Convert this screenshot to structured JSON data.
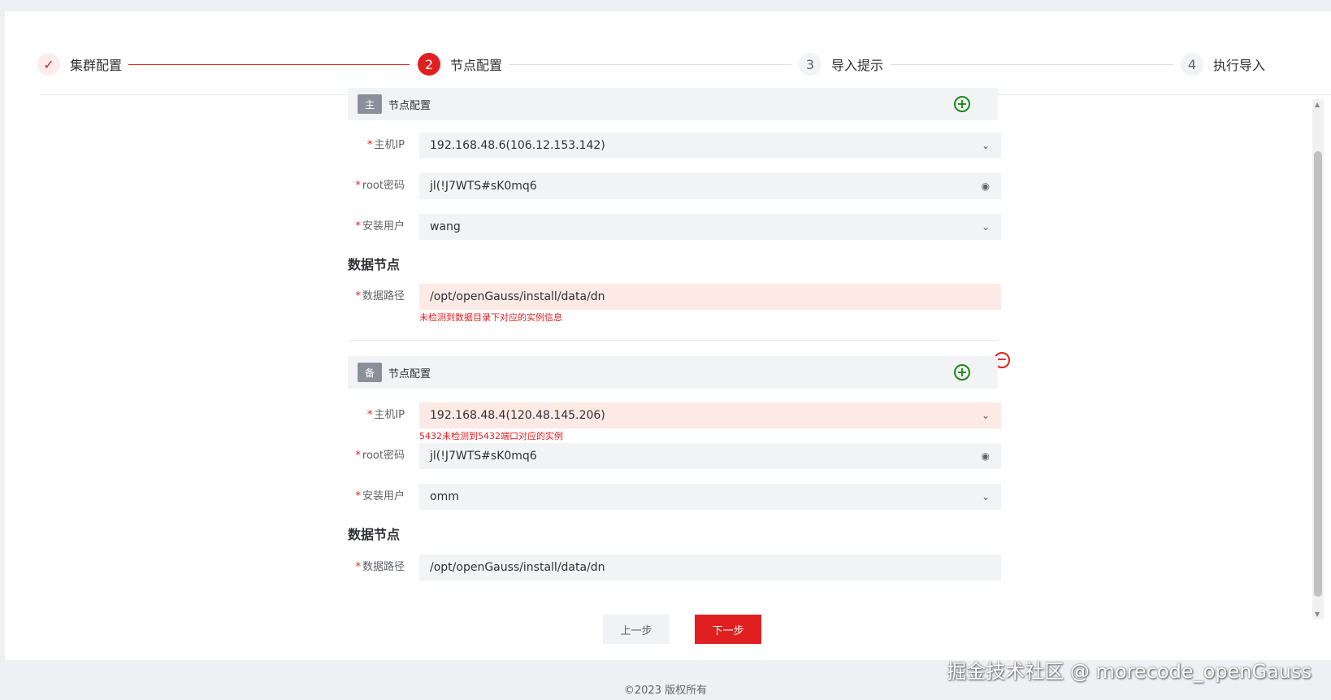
{
  "steps": [
    {
      "label": "集群配置",
      "marker": "✓",
      "state": "done"
    },
    {
      "label": "节点配置",
      "marker": "2",
      "state": "active"
    },
    {
      "label": "导入提示",
      "marker": "3",
      "state": "wait"
    },
    {
      "label": "执行导入",
      "marker": "4",
      "state": "wait"
    }
  ],
  "master": {
    "tag": "主",
    "title": "节点配置",
    "host_ip_label": "主机IP",
    "host_ip_value": "192.168.48.6(106.12.153.142)",
    "root_pwd_label": "root密码",
    "root_pwd_value": "jl(!J7WTS#sK0mq6",
    "install_user_label": "安装用户",
    "install_user_value": "wang",
    "data_node_heading": "数据节点",
    "data_path_label": "数据路径",
    "data_path_value": "/opt/openGauss/install/data/dn",
    "data_path_error": "未检测到数据目录下对应的实例信息"
  },
  "standby": {
    "tag": "备",
    "title": "节点配置",
    "host_ip_label": "主机IP",
    "host_ip_value": "192.168.48.4(120.48.145.206)",
    "host_ip_error": "5432未检测到5432端口对应的实例",
    "root_pwd_label": "root密码",
    "root_pwd_value": "jl(!J7WTS#sK0mq6",
    "install_user_label": "安装用户",
    "install_user_value": "omm",
    "data_node_heading": "数据节点",
    "data_path_label": "数据路径",
    "data_path_value": "/opt/openGauss/install/data/dn"
  },
  "icons": {
    "add": "plus-circle-icon",
    "remove": "minus-circle-icon",
    "dropdown": "chevron-down-icon",
    "password": "eye-icon"
  },
  "colors": {
    "accent": "#e02020",
    "add": "#1a8a1a"
  },
  "buttons": {
    "prev": "上一步",
    "next": "下一步"
  },
  "footer": "©2023 版权所有",
  "watermark": "掘金技术社区 @ morecode_openGauss"
}
